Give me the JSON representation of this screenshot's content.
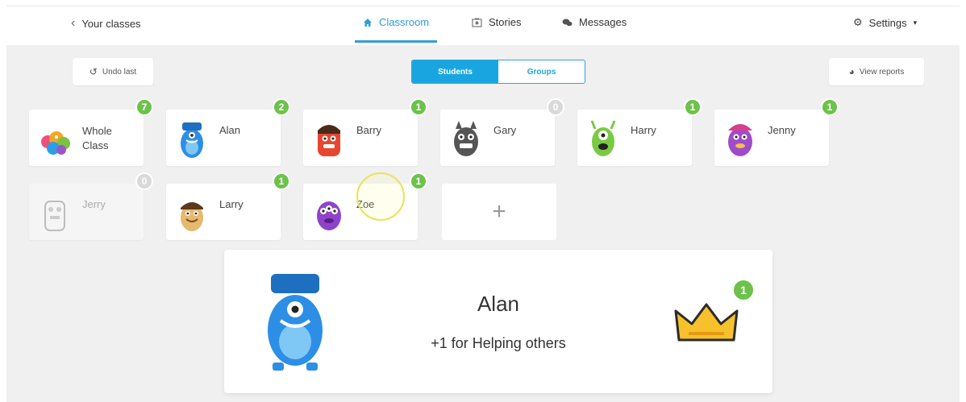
{
  "nav": {
    "back_label": "Your classes",
    "tabs": [
      {
        "label": "Classroom",
        "icon": "home-icon",
        "active": true
      },
      {
        "label": "Stories",
        "icon": "stories-icon",
        "active": false
      },
      {
        "label": "Messages",
        "icon": "chat-icon",
        "active": false
      }
    ],
    "settings_label": "Settings"
  },
  "toolbar": {
    "undo_label": "Undo last",
    "segment": {
      "students": "Students",
      "groups": "Groups"
    },
    "reports_label": "View reports"
  },
  "students": [
    {
      "name": "Whole Class",
      "points": "7"
    },
    {
      "name": "Alan",
      "points": "2"
    },
    {
      "name": "Barry",
      "points": "1"
    },
    {
      "name": "Gary",
      "points": "0"
    },
    {
      "name": "Harry",
      "points": "1"
    },
    {
      "name": "Jenny",
      "points": "1"
    },
    {
      "name": "Jerry",
      "points": "0"
    },
    {
      "name": "Larry",
      "points": "1"
    },
    {
      "name": "Zoe",
      "points": "1"
    }
  ],
  "add_symbol": "+",
  "popup": {
    "name": "Alan",
    "message": "+1 for Helping others",
    "badge": "1"
  },
  "colors": {
    "accent": "#19a6e0",
    "badge_green": "#6cc24a",
    "badge_zero": "#d9d9d9"
  }
}
